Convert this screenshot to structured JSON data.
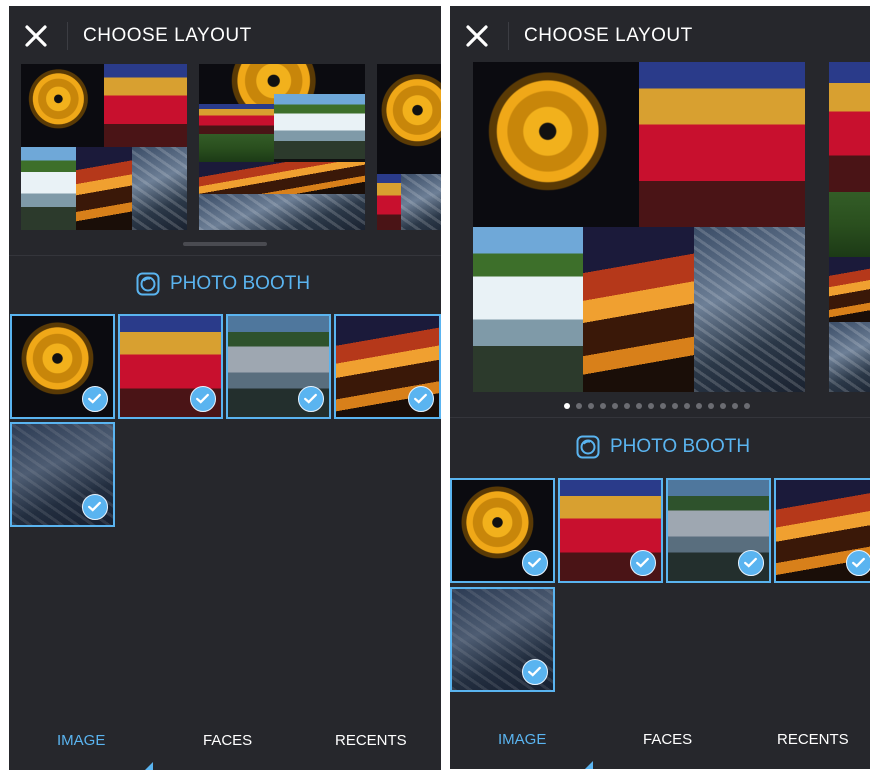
{
  "left": {
    "title": "CHOOSE LAYOUT",
    "photo_booth_label": "PHOTO BOOTH",
    "tabs": [
      {
        "label": "IMAGE",
        "active": true
      },
      {
        "label": "FACES",
        "active": false
      },
      {
        "label": "RECENTS",
        "active": false
      }
    ],
    "selected_photos": [
      "spiral-lights",
      "double-decker-bus",
      "waterfalls",
      "bridge-night",
      "city-aerial"
    ]
  },
  "right": {
    "title": "CHOOSE LAYOUT",
    "photo_booth_label": "PHOTO BOOTH",
    "tabs": [
      {
        "label": "IMAGE",
        "active": true
      },
      {
        "label": "FACES",
        "active": false
      },
      {
        "label": "RECENTS",
        "active": false
      }
    ],
    "page_dots_total": 16,
    "page_dots_active": 1,
    "selected_photos": [
      "spiral-lights",
      "double-decker-bus",
      "waterfalls",
      "bridge-night",
      "city-aerial"
    ]
  },
  "colors": {
    "background": "#26272c",
    "accent": "#5ab4f0",
    "text": "#ffffff"
  },
  "icons": {
    "close": "close-x-icon",
    "photo_booth": "camera-lens-icon",
    "selected": "checkmark-icon"
  }
}
